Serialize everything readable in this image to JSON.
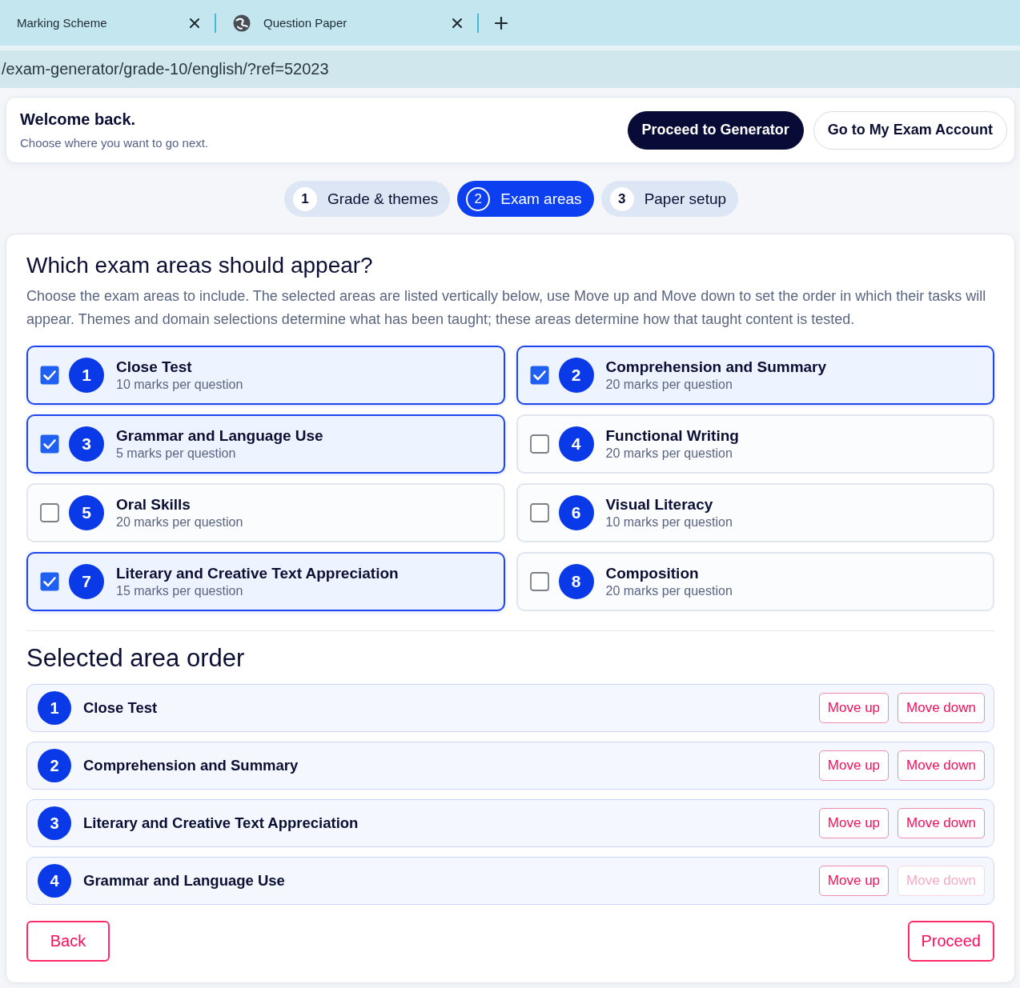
{
  "browser": {
    "tabs": [
      {
        "title": "Marking Scheme",
        "favicon": false
      },
      {
        "title": "Question Paper",
        "favicon": true
      }
    ],
    "address": "/exam-generator/grade-10/english/?ref=52023"
  },
  "header": {
    "title": "Welcome back.",
    "subtitle": "Choose where you want to go next.",
    "buttons": [
      {
        "label": "Proceed to Generator",
        "kind": "primary"
      },
      {
        "label": "Go to My Exam Account",
        "kind": "secondary"
      }
    ]
  },
  "steps": [
    {
      "number": "1",
      "label": "Grade & themes",
      "selected": false
    },
    {
      "number": "2",
      "label": "Exam areas",
      "selected": true
    },
    {
      "number": "3",
      "label": "Paper setup",
      "selected": false
    }
  ],
  "areas": {
    "title": "Which exam areas should appear?",
    "description": "Choose the exam areas to include. The selected areas are listed vertically below, use Move up and Move down to set the order in which their tasks will appear. Themes and domain selections determine what has been taught; these areas determine how that taught content is tested.",
    "options": [
      {
        "number": "1",
        "title": "Close Test",
        "marks": "10 marks per question",
        "checked": true
      },
      {
        "number": "2",
        "title": "Comprehension and Summary",
        "marks": "20 marks per question",
        "checked": true
      },
      {
        "number": "3",
        "title": "Grammar and Language Use",
        "marks": "5 marks per question",
        "checked": true
      },
      {
        "number": "4",
        "title": "Functional Writing",
        "marks": "20 marks per question",
        "checked": false
      },
      {
        "number": "5",
        "title": "Oral Skills",
        "marks": "20 marks per question",
        "checked": false
      },
      {
        "number": "6",
        "title": "Visual Literacy",
        "marks": "10 marks per question",
        "checked": false
      },
      {
        "number": "7",
        "title": "Literary and Creative Text Appreciation",
        "marks": "15 marks per question",
        "checked": true
      },
      {
        "number": "8",
        "title": "Composition",
        "marks": "20 marks per question",
        "checked": false
      }
    ]
  },
  "order": {
    "title": "Selected area order",
    "items": [
      {
        "number": "1",
        "title": "Close Test",
        "buttons": [
          {
            "label": "Move up",
            "disabled": false
          },
          {
            "label": "Move down",
            "disabled": false
          }
        ]
      },
      {
        "number": "2",
        "title": "Comprehension and Summary",
        "buttons": [
          {
            "label": "Move up",
            "disabled": false
          },
          {
            "label": "Move down",
            "disabled": false
          }
        ]
      },
      {
        "number": "3",
        "title": "Literary and Creative Text Appreciation",
        "buttons": [
          {
            "label": "Move up",
            "disabled": false
          },
          {
            "label": "Move down",
            "disabled": false
          }
        ]
      },
      {
        "number": "4",
        "title": "Grammar and Language Use",
        "buttons": [
          {
            "label": "Move up",
            "disabled": false
          },
          {
            "label": "Move down",
            "disabled": true
          }
        ]
      }
    ]
  },
  "actions": [
    {
      "label": "Back"
    },
    {
      "label": "Proceed"
    }
  ]
}
